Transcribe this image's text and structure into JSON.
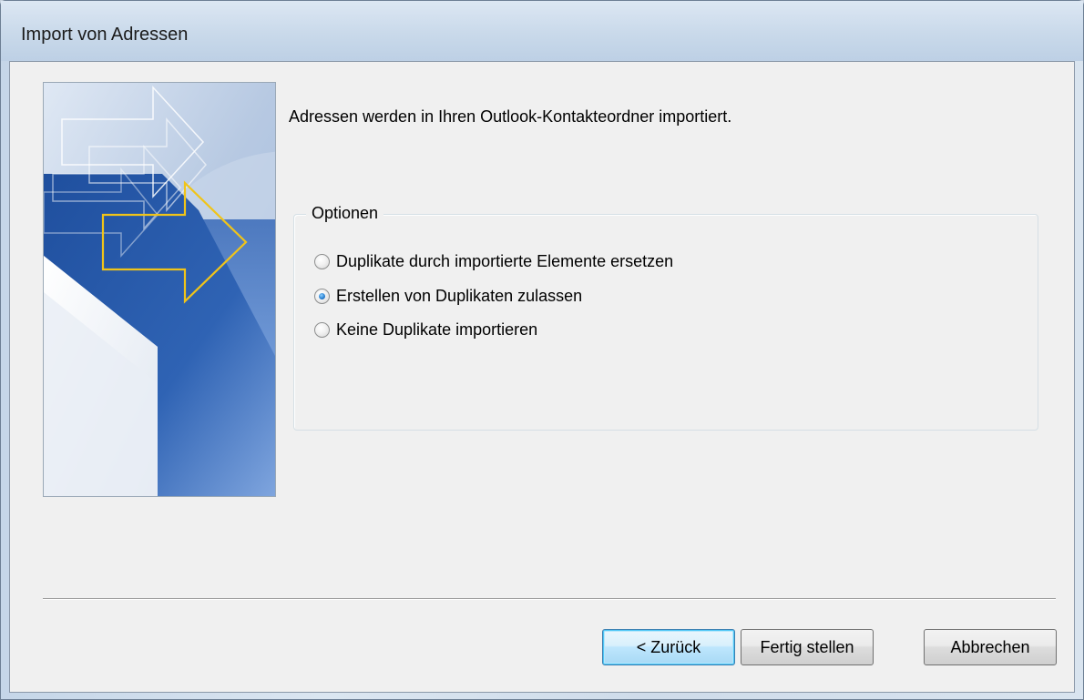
{
  "window": {
    "title": "Import von Adressen"
  },
  "wizard": {
    "intro_text": "Adressen werden in Ihren Outlook-Kontakteordner importiert.",
    "options_group": {
      "legend": "Optionen",
      "options": [
        {
          "label": "Duplikate durch importierte Elemente ersetzen",
          "selected": false
        },
        {
          "label": "Erstellen von Duplikaten zulassen",
          "selected": true
        },
        {
          "label": "Keine Duplikate importieren",
          "selected": false
        }
      ]
    }
  },
  "buttons": {
    "back": "< Zurück",
    "finish": "Fertig stellen",
    "cancel": "Abbrechen"
  },
  "colors": {
    "accent_arrow": "#f0c419",
    "art_blue": "#2f5ea9",
    "default_button": "#bee6fd"
  }
}
